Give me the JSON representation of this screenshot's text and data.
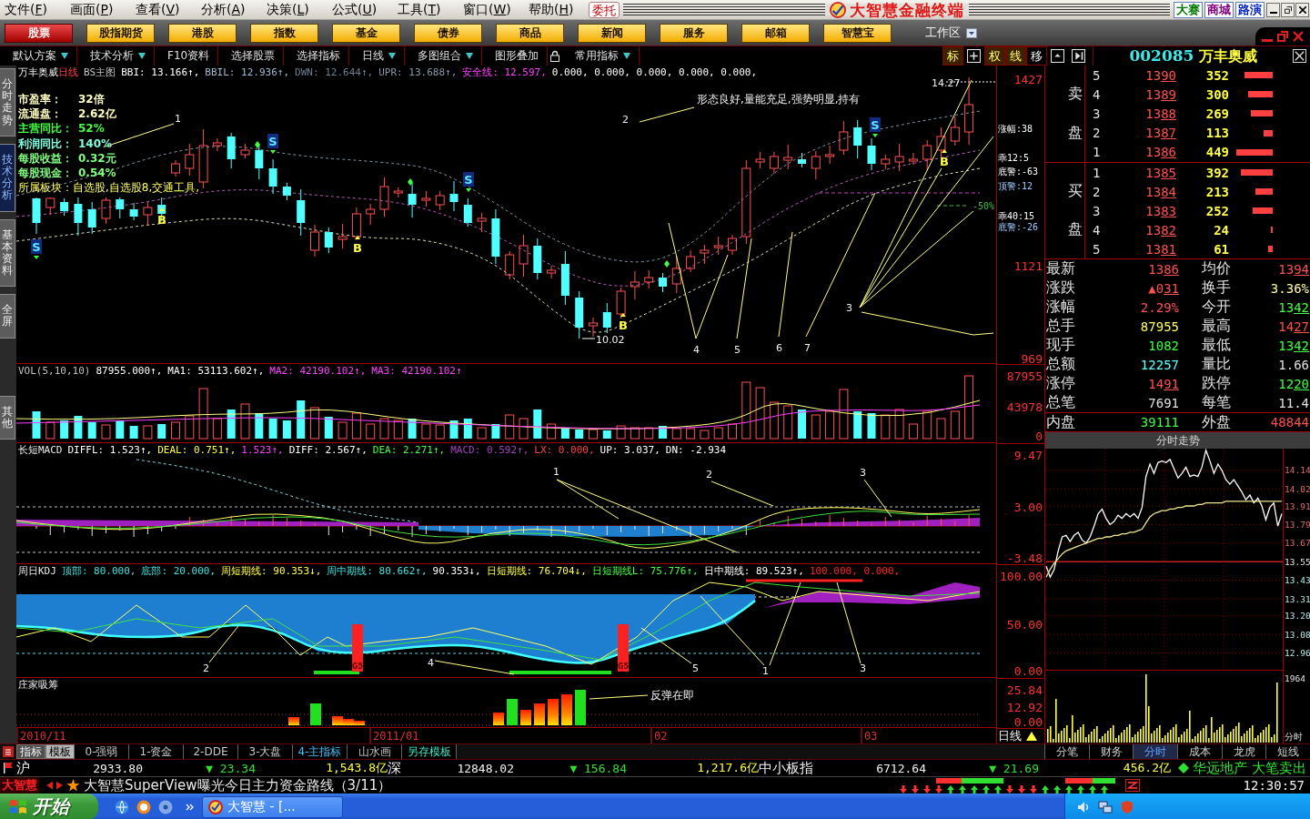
{
  "menu_bar": {
    "items": [
      "文件(F)",
      "画面(P)",
      "查看(V)",
      "分析(A)",
      "决策(L)",
      "公式(U)",
      "工具(T)",
      "窗口(W)",
      "帮助(H)"
    ],
    "order_button": "委托",
    "app_title": "大智慧金融终端",
    "links": [
      {
        "label": "大赛",
        "color": "#007a00"
      },
      {
        "label": "商城",
        "color": "#800080"
      },
      {
        "label": "路演",
        "color": "#0020c0"
      }
    ]
  },
  "nav_tabs": [
    {
      "label": "股票",
      "selected": true
    },
    {
      "label": "股指期货",
      "selected": false
    },
    {
      "label": "港股",
      "selected": false
    },
    {
      "label": "指数",
      "selected": false
    },
    {
      "label": "基金",
      "selected": false
    },
    {
      "label": "债券",
      "selected": false
    },
    {
      "label": "商品",
      "selected": false
    },
    {
      "label": "新闻",
      "selected": false
    },
    {
      "label": "服务",
      "selected": false
    },
    {
      "label": "邮箱",
      "selected": false
    },
    {
      "label": "智慧宝",
      "selected": false
    }
  ],
  "workspace": {
    "label": "工作区"
  },
  "toolbar": {
    "items": [
      {
        "label": "默认方案",
        "dropdown": true,
        "locked": false
      },
      {
        "label": "技术分析",
        "dropdown": true,
        "locked": false
      },
      {
        "label": "F10资料",
        "dropdown": false,
        "locked": false
      },
      {
        "label": "选择股票",
        "dropdown": false,
        "locked": false
      },
      {
        "label": "选择指标",
        "dropdown": false,
        "locked": false
      },
      {
        "label": "日线",
        "dropdown": true,
        "locked": false
      },
      {
        "label": "多图组合",
        "dropdown": true,
        "locked": false
      },
      {
        "label": "图形叠加",
        "dropdown": false,
        "locked": false
      },
      {
        "label": "常用指标",
        "dropdown": true,
        "locked": true
      }
    ],
    "toggles": [
      {
        "label": "标",
        "on": true
      },
      {
        "label": "权",
        "on": true
      },
      {
        "label": "线",
        "on": true
      },
      {
        "label": "移",
        "on": false
      }
    ]
  },
  "stock_header": {
    "code": "002085",
    "name": "万丰奥威"
  },
  "side_tabs": [
    {
      "label": "分时走势",
      "selected": false
    },
    {
      "label": "技术分析",
      "selected": true
    },
    {
      "label": "基本资料",
      "selected": false
    },
    {
      "label": "全屏",
      "selected": false
    },
    {
      "label": "其他",
      "selected": false
    }
  ],
  "main_chart": {
    "title": "万丰奥威",
    "period": "日线",
    "template": "BS主图",
    "legend": [
      {
        "text": "BBI: 13.166↑,",
        "color": "#ffffff"
      },
      {
        "text": "BBIL: 12.936↑,",
        "color": "#a0b8d0"
      },
      {
        "text": "DWN: 12.644↑,",
        "color": "#708090"
      },
      {
        "text": "UPR: 13.688↑,",
        "color": "#8898a8"
      },
      {
        "text": "安全线: 12.597,",
        "color": "#ff40ff"
      },
      {
        "text": "0.000, 0.000, 0.000, 0.000, 0.000,",
        "color": "#ffffff"
      }
    ],
    "info": [
      {
        "label": "市盈率：",
        "value": "32倍",
        "color": "#ffffc0"
      },
      {
        "label": "流通盘：",
        "value": "2.62亿",
        "color": "#ffffc0"
      },
      {
        "label": "主营同比：",
        "value": "52%",
        "color": "#40ff40"
      },
      {
        "label": "利润同比：",
        "value": "140%",
        "color": "#80ffe0"
      },
      {
        "label": "每股收益：",
        "value": "0.32元",
        "color": "#80ff80"
      },
      {
        "label": "每股现金：",
        "value": "0.54%",
        "color": "#80ff80"
      }
    ],
    "sector": "所属板块：自选股,自选股8,交通工具,",
    "signals": [
      {
        "kind": "sell",
        "text": "S"
      },
      {
        "kind": "buy",
        "text": "B"
      },
      {
        "kind": "sell",
        "text": "S"
      },
      {
        "kind": "buy",
        "text": "B"
      },
      {
        "kind": "sell",
        "text": "S"
      },
      {
        "kind": "buy",
        "text": "B"
      },
      {
        "kind": "sell",
        "text": "S"
      },
      {
        "kind": "buy",
        "text": "B"
      }
    ],
    "annotations": [
      "1",
      "2",
      "形态良好,量能充足,强势明显,持有",
      "14.27",
      "10.02",
      "3",
      "4",
      "5",
      "6",
      "7"
    ],
    "side_notes": [
      {
        "text": "涨幅:38",
        "color": "#ffffff"
      },
      {
        "text": "乖12:5",
        "color": "#ffffff"
      },
      {
        "text": "底警:-63",
        "color": "#ffffff"
      },
      {
        "text": "顶警:12",
        "color": "#a0c8ff"
      },
      {
        "text": "-50%",
        "color": "#40c040"
      },
      {
        "text": "乖40:15",
        "color": "#ffffff"
      },
      {
        "text": "底警:-26",
        "color": "#a0c8ff"
      }
    ],
    "axis": [
      "1427",
      "1121",
      "969"
    ]
  },
  "volume_chart": {
    "legend": [
      {
        "text": "VOL(5,10,10)",
        "color": "#c0c0c0"
      },
      {
        "text": "87955.000↑,",
        "color": "#ffffff"
      },
      {
        "text": "MA1: 53113.602↑,",
        "color": "#ffffff"
      },
      {
        "text": "MA2: 42190.102↑,",
        "color": "#ff40ff"
      },
      {
        "text": "MA3: 42190.102↑",
        "color": "#ff40ff"
      }
    ],
    "axis": [
      "87955",
      "43978",
      "0"
    ]
  },
  "macd_chart": {
    "title": "长短MACD",
    "legend": [
      {
        "text": "DIFFL: 1.523↑,",
        "color": "#ffffff"
      },
      {
        "text": "DEAL: 0.751↑,",
        "color": "#ffff40"
      },
      {
        "text": "1.523↑,",
        "color": "#ff40ff"
      },
      {
        "text": "DIFF: 2.567↑,",
        "color": "#ffffff"
      },
      {
        "text": "DEA: 2.271↑,",
        "color": "#40ff40"
      },
      {
        "text": "MACD: 0.592↑,",
        "color": "#a040c0"
      },
      {
        "text": "LX: 0.000,",
        "color": "#ff4040"
      },
      {
        "text": "UP: 3.037,",
        "color": "#ffffff"
      },
      {
        "text": "DN: -2.934",
        "color": "#ffffff"
      }
    ],
    "labels": [
      "1",
      "2",
      "3"
    ],
    "axis": [
      "9.47",
      "3.00",
      "-3.48"
    ]
  },
  "kdj_chart": {
    "title": "周日KDJ",
    "legend": [
      {
        "text": "顶部: 80.000,",
        "color": "#40e0e0"
      },
      {
        "text": "底部: 20.000,",
        "color": "#40e0e0"
      },
      {
        "text": "周短期线: 90.353↓,",
        "color": "#ffff40"
      },
      {
        "text": "周中期线: 80.662↑,",
        "color": "#40e0e0"
      },
      {
        "text": "90.353↓,",
        "color": "#ffffff"
      },
      {
        "text": "日短期线: 76.704↓,",
        "color": "#ffff40"
      },
      {
        "text": "日短期线L: 75.776↑,",
        "color": "#40ff40"
      },
      {
        "text": "日中期线: 89.523↑,",
        "color": "#ffffff"
      },
      {
        "text": "100.000, 0.000,",
        "color": "#ff2020"
      }
    ],
    "labels": [
      "2",
      "4",
      "5",
      "1",
      "3"
    ],
    "markers": [
      "G5",
      "G5"
    ],
    "axis": [
      "100.00",
      "50.00",
      "0.00"
    ]
  },
  "accumulation_chart": {
    "title": "庄家吸筹",
    "note": "反弹在即",
    "axis": [
      "25.84",
      "12.92",
      "0.00"
    ]
  },
  "date_axis": {
    "labels": [
      "2010/11",
      "2011/01",
      "02",
      "03"
    ],
    "period": "日线"
  },
  "mode_switch": [
    {
      "label": "指标",
      "selected": false
    },
    {
      "label": "模板",
      "selected": true
    }
  ],
  "template_tabs": [
    {
      "label": "0-强弱",
      "selected": false
    },
    {
      "label": "1-资金",
      "selected": false
    },
    {
      "label": "2-DDE",
      "selected": false
    },
    {
      "label": "3-大盘",
      "selected": false
    },
    {
      "label": "4-主指标",
      "selected": true
    },
    {
      "label": "山水画",
      "selected": false
    }
  ],
  "save_template": "另存模板",
  "order_book": {
    "sell_label": [
      "卖",
      "盘"
    ],
    "buy_label": [
      "买",
      "盘"
    ],
    "asks": [
      {
        "rank": "5",
        "price": "1390",
        "volume": "352"
      },
      {
        "rank": "4",
        "price": "1389",
        "volume": "300"
      },
      {
        "rank": "3",
        "price": "1388",
        "volume": "269"
      },
      {
        "rank": "2",
        "price": "1387",
        "volume": "113"
      },
      {
        "rank": "1",
        "price": "1386",
        "volume": "449"
      }
    ],
    "bids": [
      {
        "rank": "1",
        "price": "1385",
        "volume": "392"
      },
      {
        "rank": "2",
        "price": "1384",
        "volume": "213"
      },
      {
        "rank": "3",
        "price": "1383",
        "volume": "252"
      },
      {
        "rank": "4",
        "price": "1382",
        "volume": "24"
      },
      {
        "rank": "5",
        "price": "1381",
        "volume": "61"
      }
    ]
  },
  "quote": [
    {
      "label": "最新",
      "value": "1386",
      "color": "#ff5050",
      "kind": "price"
    },
    {
      "label": "均价",
      "value": "1394",
      "color": "#ff5050",
      "kind": "price"
    },
    {
      "label": "涨跌",
      "value": "▲031",
      "color": "#ff5050",
      "kind": "price"
    },
    {
      "label": "换手",
      "value": "3.36%",
      "color": "#ffffa0",
      "kind": "plain"
    },
    {
      "label": "涨幅",
      "value": "2.29%",
      "color": "#ff5050",
      "kind": "plain"
    },
    {
      "label": "今开",
      "value": "1342",
      "color": "#40ff40",
      "kind": "price"
    },
    {
      "label": "总手",
      "value": "87955",
      "color": "#ffff60",
      "kind": "plain"
    },
    {
      "label": "最高",
      "value": "1427",
      "color": "#ff5050",
      "kind": "price"
    },
    {
      "label": "现手",
      "value": "1082",
      "color": "#40ff40",
      "kind": "plain"
    },
    {
      "label": "最低",
      "value": "1342",
      "color": "#40ff40",
      "kind": "price"
    },
    {
      "label": "总额",
      "value": "12257",
      "color": "#60ffff",
      "kind": "plain"
    },
    {
      "label": "量比",
      "value": "1.66",
      "color": "#e0e0e0",
      "kind": "plain"
    },
    {
      "label": "涨停",
      "value": "1491",
      "color": "#ff5050",
      "kind": "price"
    },
    {
      "label": "跌停",
      "value": "1220",
      "color": "#40ff40",
      "kind": "price"
    },
    {
      "label": "总笔",
      "value": "7691",
      "color": "#e0e0e0",
      "kind": "plain"
    },
    {
      "label": "每笔",
      "value": "11.4",
      "color": "#e0e0e0",
      "kind": "plain"
    }
  ],
  "inner_outer": [
    {
      "label": "内盘",
      "value": "39111",
      "color": "#40ff40"
    },
    {
      "label": "外盘",
      "value": "48844",
      "color": "#ff5050"
    }
  ],
  "intraday": {
    "title": "分时走势",
    "volume_axis": "1964",
    "period": "分时",
    "chart_data": {
      "type": "line",
      "grid": true,
      "ylim": [
        12.37,
        14.28
      ],
      "yticks": [
        {
          "value": 14.14,
          "label": "14.14"
        },
        {
          "value": 14.02,
          "label": "14.02"
        },
        {
          "value": 13.91,
          "label": "13.91"
        },
        {
          "value": 13.79,
          "label": "13.79"
        },
        {
          "value": 13.67,
          "label": "13.67"
        },
        {
          "value": 13.55,
          "label": "13.55"
        },
        {
          "value": 13.43,
          "label": "13.43"
        },
        {
          "value": 13.31,
          "label": "13.31"
        },
        {
          "value": 13.2,
          "label": "13.20"
        },
        {
          "value": 13.08,
          "label": "13.08"
        },
        {
          "value": 12.96,
          "label": "12.96"
        }
      ],
      "ref_lines": [
        {
          "axis": "y",
          "value": 13.55
        }
      ],
      "series": [
        {
          "color": "#ffffff",
          "values": [
            13.52,
            13.45,
            13.5,
            13.62,
            13.71,
            13.72,
            13.68,
            13.72,
            13.74,
            13.69,
            13.67,
            13.71,
            13.78,
            13.86,
            13.89,
            13.83,
            13.79,
            13.81,
            13.85,
            13.83,
            13.86,
            13.84,
            13.86,
            13.83,
            13.9,
            14.1,
            14.18,
            14.12,
            14.19,
            14.2,
            14.19,
            14.21,
            14.15,
            14.09,
            14.12,
            14.16,
            14.1,
            14.11,
            14.1,
            14.16,
            14.27,
            14.2,
            14.12,
            14.18,
            14.14,
            14.08,
            14.05,
            14.08,
            14.04,
            14.0,
            13.95,
            13.98,
            13.93,
            13.96,
            13.91,
            13.82,
            13.9,
            13.93,
            13.78,
            13.86
          ]
        },
        {
          "color": "#f0e890",
          "values": [
            13.45,
            13.5,
            13.54,
            13.57,
            13.6,
            13.62,
            13.63,
            13.64,
            13.65,
            13.66,
            13.67,
            13.68,
            13.69,
            13.7,
            13.7,
            13.71,
            13.71,
            13.72,
            13.72,
            13.73,
            13.73,
            13.74,
            13.74,
            13.75,
            13.76,
            13.8,
            13.84,
            13.86,
            13.87,
            13.88,
            13.88,
            13.89,
            13.89,
            13.9,
            13.9,
            13.91,
            13.91,
            13.91,
            13.92,
            13.92,
            13.93,
            13.93,
            13.93,
            13.93,
            13.93,
            13.94,
            13.94,
            13.94,
            13.94,
            13.94,
            13.94,
            13.94,
            13.94,
            13.94,
            13.94,
            13.94,
            13.94,
            13.94,
            13.94,
            13.94
          ]
        }
      ]
    }
  },
  "panel_tabs": [
    {
      "label": "分笔",
      "selected": false
    },
    {
      "label": "财务",
      "selected": false
    },
    {
      "label": "分时",
      "selected": true
    },
    {
      "label": "成本",
      "selected": false
    },
    {
      "label": "龙虎",
      "selected": false
    },
    {
      "label": "短线",
      "selected": false
    }
  ],
  "market_bar": {
    "indices": [
      {
        "name": "沪",
        "value": "2933.80",
        "change": "▼ 23.34",
        "turnover": "1,543.8亿"
      },
      {
        "name": "深",
        "value": "12848.02",
        "change": "▼ 156.84",
        "turnover": "1,217.6亿"
      },
      {
        "name": "中小板指",
        "value": "6712.64",
        "change": "▼ 21.69",
        "turnover": "456.2亿"
      }
    ],
    "alert": "华远地产 大笔卖出"
  },
  "ticker": {
    "brand": "大智慧",
    "headline": "大智慧SuperView曝光今日主力资金路线（3/11）",
    "arrows": [
      {
        "kind": "down"
      },
      {
        "kind": "down"
      },
      {
        "kind": "down"
      },
      {
        "kind": "down"
      },
      {
        "kind": "up"
      },
      {
        "kind": "up"
      },
      {
        "kind": "up"
      },
      {
        "kind": "up"
      },
      {
        "kind": "up"
      },
      {
        "kind": "down"
      },
      {
        "kind": "down"
      },
      {
        "kind": "down"
      },
      {
        "kind": "up"
      },
      {
        "kind": "up"
      },
      {
        "kind": "up"
      },
      {
        "kind": "up"
      },
      {
        "kind": "up"
      },
      {
        "kind": "up"
      }
    ],
    "time": "12:30:57"
  },
  "taskbar": {
    "start": "开始",
    "tasks": [
      "大智慧 - [..."
    ]
  }
}
